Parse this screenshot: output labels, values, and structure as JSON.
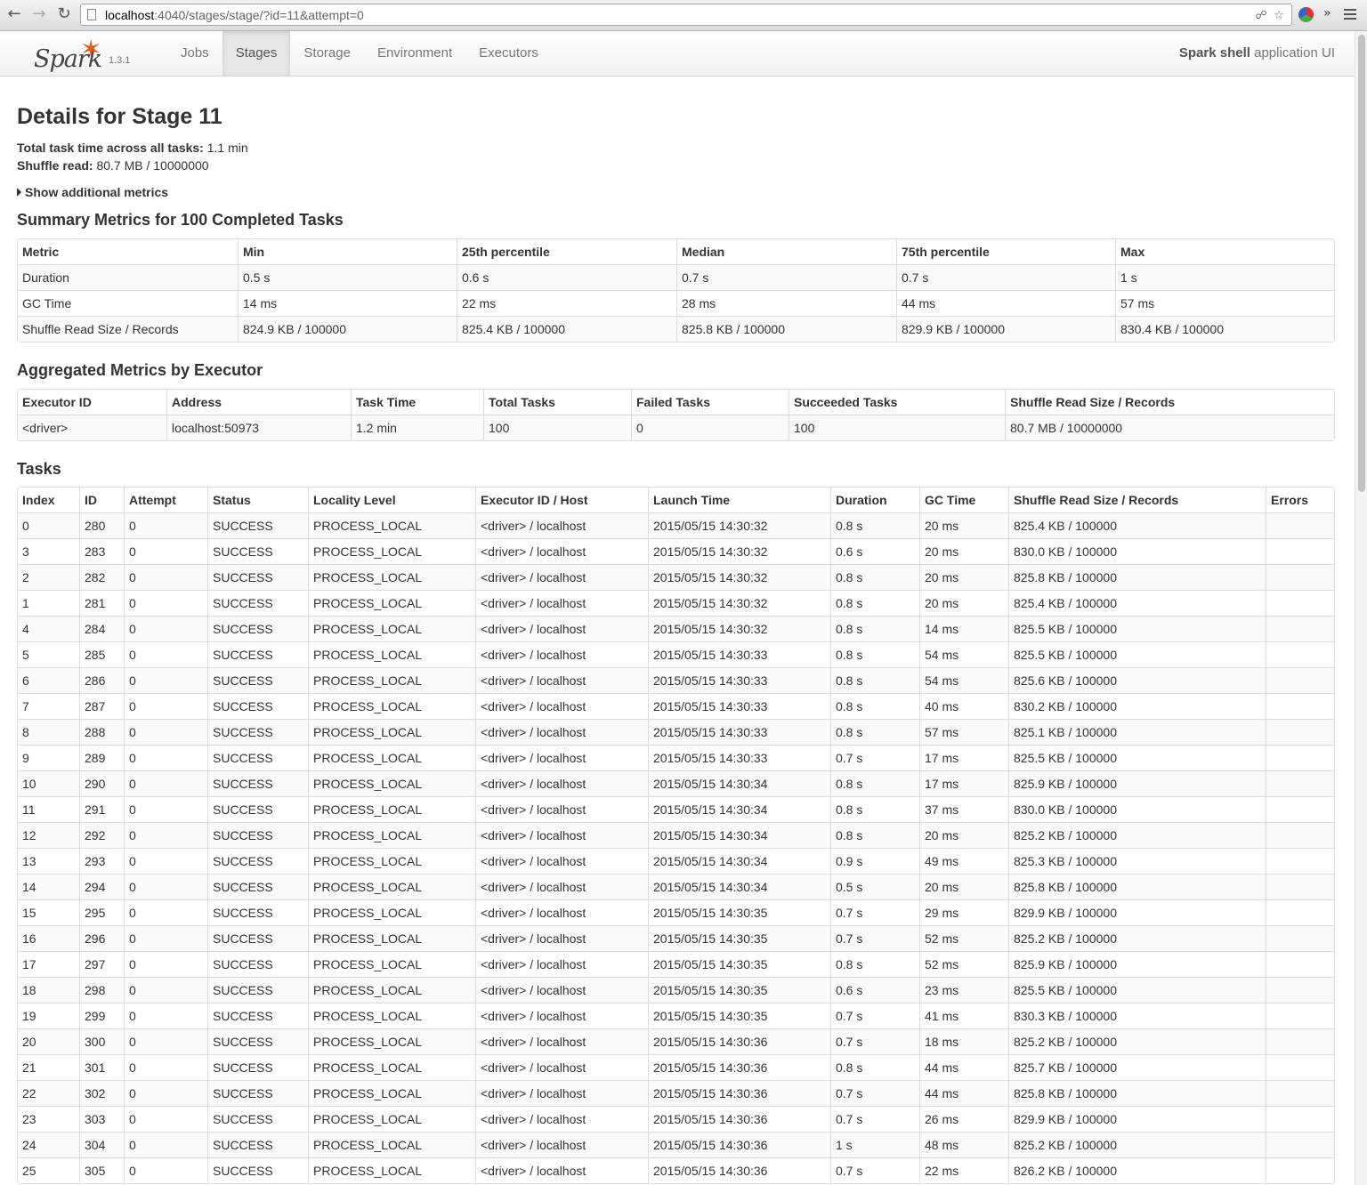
{
  "browser": {
    "url_host": "localhost",
    "url_rest": ":4040/stages/stage/?id=11&attempt=0",
    "back_icon": "arrow-left",
    "forward_icon": "arrow-right",
    "reload_icon": "reload"
  },
  "navbar": {
    "logo_text": "Spark",
    "version": "1.3.1",
    "tabs": [
      {
        "label": "Jobs",
        "active": false
      },
      {
        "label": "Stages",
        "active": true
      },
      {
        "label": "Storage",
        "active": false
      },
      {
        "label": "Environment",
        "active": false
      },
      {
        "label": "Executors",
        "active": false
      }
    ],
    "app_name": "Spark shell",
    "app_suffix": " application UI"
  },
  "page": {
    "title": "Details for Stage 11",
    "total_task_time_label": "Total task time across all tasks:",
    "total_task_time_value": "1.1 min",
    "shuffle_read_label": "Shuffle read:",
    "shuffle_read_value": "80.7 MB / 10000000",
    "additional_metrics": "Show additional metrics"
  },
  "summary": {
    "heading": "Summary Metrics for 100 Completed Tasks",
    "headers": [
      "Metric",
      "Min",
      "25th percentile",
      "Median",
      "75th percentile",
      "Max"
    ],
    "rows": [
      [
        "Duration",
        "0.5 s",
        "0.6 s",
        "0.7 s",
        "0.7 s",
        "1 s"
      ],
      [
        "GC Time",
        "14 ms",
        "22 ms",
        "28 ms",
        "44 ms",
        "57 ms"
      ],
      [
        "Shuffle Read Size / Records",
        "824.9 KB / 100000",
        "825.4 KB / 100000",
        "825.8 KB / 100000",
        "829.9 KB / 100000",
        "830.4 KB / 100000"
      ]
    ]
  },
  "aggregated": {
    "heading": "Aggregated Metrics by Executor",
    "headers": [
      "Executor ID",
      "Address",
      "Task Time",
      "Total Tasks",
      "Failed Tasks",
      "Succeeded Tasks",
      "Shuffle Read Size / Records"
    ],
    "rows": [
      [
        "<driver>",
        "localhost:50973",
        "1.2 min",
        "100",
        "0",
        "100",
        "80.7 MB / 10000000"
      ]
    ]
  },
  "tasks": {
    "heading": "Tasks",
    "headers": [
      "Index",
      "ID",
      "Attempt",
      "Status",
      "Locality Level",
      "Executor ID / Host",
      "Launch Time",
      "Duration",
      "GC Time",
      "Shuffle Read Size / Records",
      "Errors"
    ],
    "rows": [
      [
        "0",
        "280",
        "0",
        "SUCCESS",
        "PROCESS_LOCAL",
        "<driver> / localhost",
        "2015/05/15 14:30:32",
        "0.8 s",
        "20 ms",
        "825.4 KB / 100000",
        ""
      ],
      [
        "3",
        "283",
        "0",
        "SUCCESS",
        "PROCESS_LOCAL",
        "<driver> / localhost",
        "2015/05/15 14:30:32",
        "0.6 s",
        "20 ms",
        "830.0 KB / 100000",
        ""
      ],
      [
        "2",
        "282",
        "0",
        "SUCCESS",
        "PROCESS_LOCAL",
        "<driver> / localhost",
        "2015/05/15 14:30:32",
        "0.8 s",
        "20 ms",
        "825.8 KB / 100000",
        ""
      ],
      [
        "1",
        "281",
        "0",
        "SUCCESS",
        "PROCESS_LOCAL",
        "<driver> / localhost",
        "2015/05/15 14:30:32",
        "0.8 s",
        "20 ms",
        "825.4 KB / 100000",
        ""
      ],
      [
        "4",
        "284",
        "0",
        "SUCCESS",
        "PROCESS_LOCAL",
        "<driver> / localhost",
        "2015/05/15 14:30:32",
        "0.8 s",
        "14 ms",
        "825.5 KB / 100000",
        ""
      ],
      [
        "5",
        "285",
        "0",
        "SUCCESS",
        "PROCESS_LOCAL",
        "<driver> / localhost",
        "2015/05/15 14:30:33",
        "0.8 s",
        "54 ms",
        "825.5 KB / 100000",
        ""
      ],
      [
        "6",
        "286",
        "0",
        "SUCCESS",
        "PROCESS_LOCAL",
        "<driver> / localhost",
        "2015/05/15 14:30:33",
        "0.8 s",
        "54 ms",
        "825.6 KB / 100000",
        ""
      ],
      [
        "7",
        "287",
        "0",
        "SUCCESS",
        "PROCESS_LOCAL",
        "<driver> / localhost",
        "2015/05/15 14:30:33",
        "0.8 s",
        "40 ms",
        "830.2 KB / 100000",
        ""
      ],
      [
        "8",
        "288",
        "0",
        "SUCCESS",
        "PROCESS_LOCAL",
        "<driver> / localhost",
        "2015/05/15 14:30:33",
        "0.8 s",
        "57 ms",
        "825.1 KB / 100000",
        ""
      ],
      [
        "9",
        "289",
        "0",
        "SUCCESS",
        "PROCESS_LOCAL",
        "<driver> / localhost",
        "2015/05/15 14:30:33",
        "0.7 s",
        "17 ms",
        "825.5 KB / 100000",
        ""
      ],
      [
        "10",
        "290",
        "0",
        "SUCCESS",
        "PROCESS_LOCAL",
        "<driver> / localhost",
        "2015/05/15 14:30:34",
        "0.8 s",
        "17 ms",
        "825.9 KB / 100000",
        ""
      ],
      [
        "11",
        "291",
        "0",
        "SUCCESS",
        "PROCESS_LOCAL",
        "<driver> / localhost",
        "2015/05/15 14:30:34",
        "0.8 s",
        "37 ms",
        "830.0 KB / 100000",
        ""
      ],
      [
        "12",
        "292",
        "0",
        "SUCCESS",
        "PROCESS_LOCAL",
        "<driver> / localhost",
        "2015/05/15 14:30:34",
        "0.8 s",
        "20 ms",
        "825.2 KB / 100000",
        ""
      ],
      [
        "13",
        "293",
        "0",
        "SUCCESS",
        "PROCESS_LOCAL",
        "<driver> / localhost",
        "2015/05/15 14:30:34",
        "0.9 s",
        "49 ms",
        "825.3 KB / 100000",
        ""
      ],
      [
        "14",
        "294",
        "0",
        "SUCCESS",
        "PROCESS_LOCAL",
        "<driver> / localhost",
        "2015/05/15 14:30:34",
        "0.5 s",
        "20 ms",
        "825.8 KB / 100000",
        ""
      ],
      [
        "15",
        "295",
        "0",
        "SUCCESS",
        "PROCESS_LOCAL",
        "<driver> / localhost",
        "2015/05/15 14:30:35",
        "0.7 s",
        "29 ms",
        "829.9 KB / 100000",
        ""
      ],
      [
        "16",
        "296",
        "0",
        "SUCCESS",
        "PROCESS_LOCAL",
        "<driver> / localhost",
        "2015/05/15 14:30:35",
        "0.7 s",
        "52 ms",
        "825.2 KB / 100000",
        ""
      ],
      [
        "17",
        "297",
        "0",
        "SUCCESS",
        "PROCESS_LOCAL",
        "<driver> / localhost",
        "2015/05/15 14:30:35",
        "0.8 s",
        "52 ms",
        "825.9 KB / 100000",
        ""
      ],
      [
        "18",
        "298",
        "0",
        "SUCCESS",
        "PROCESS_LOCAL",
        "<driver> / localhost",
        "2015/05/15 14:30:35",
        "0.6 s",
        "23 ms",
        "825.5 KB / 100000",
        ""
      ],
      [
        "19",
        "299",
        "0",
        "SUCCESS",
        "PROCESS_LOCAL",
        "<driver> / localhost",
        "2015/05/15 14:30:35",
        "0.7 s",
        "41 ms",
        "830.3 KB / 100000",
        ""
      ],
      [
        "20",
        "300",
        "0",
        "SUCCESS",
        "PROCESS_LOCAL",
        "<driver> / localhost",
        "2015/05/15 14:30:36",
        "0.7 s",
        "18 ms",
        "825.2 KB / 100000",
        ""
      ],
      [
        "21",
        "301",
        "0",
        "SUCCESS",
        "PROCESS_LOCAL",
        "<driver> / localhost",
        "2015/05/15 14:30:36",
        "0.8 s",
        "44 ms",
        "825.7 KB / 100000",
        ""
      ],
      [
        "22",
        "302",
        "0",
        "SUCCESS",
        "PROCESS_LOCAL",
        "<driver> / localhost",
        "2015/05/15 14:30:36",
        "0.7 s",
        "44 ms",
        "825.8 KB / 100000",
        ""
      ],
      [
        "23",
        "303",
        "0",
        "SUCCESS",
        "PROCESS_LOCAL",
        "<driver> / localhost",
        "2015/05/15 14:30:36",
        "0.7 s",
        "26 ms",
        "829.9 KB / 100000",
        ""
      ],
      [
        "24",
        "304",
        "0",
        "SUCCESS",
        "PROCESS_LOCAL",
        "<driver> / localhost",
        "2015/05/15 14:30:36",
        "1 s",
        "48 ms",
        "825.2 KB / 100000",
        ""
      ],
      [
        "25",
        "305",
        "0",
        "SUCCESS",
        "PROCESS_LOCAL",
        "<driver> / localhost",
        "2015/05/15 14:30:36",
        "0.7 s",
        "22 ms",
        "826.2 KB / 100000",
        ""
      ]
    ]
  }
}
